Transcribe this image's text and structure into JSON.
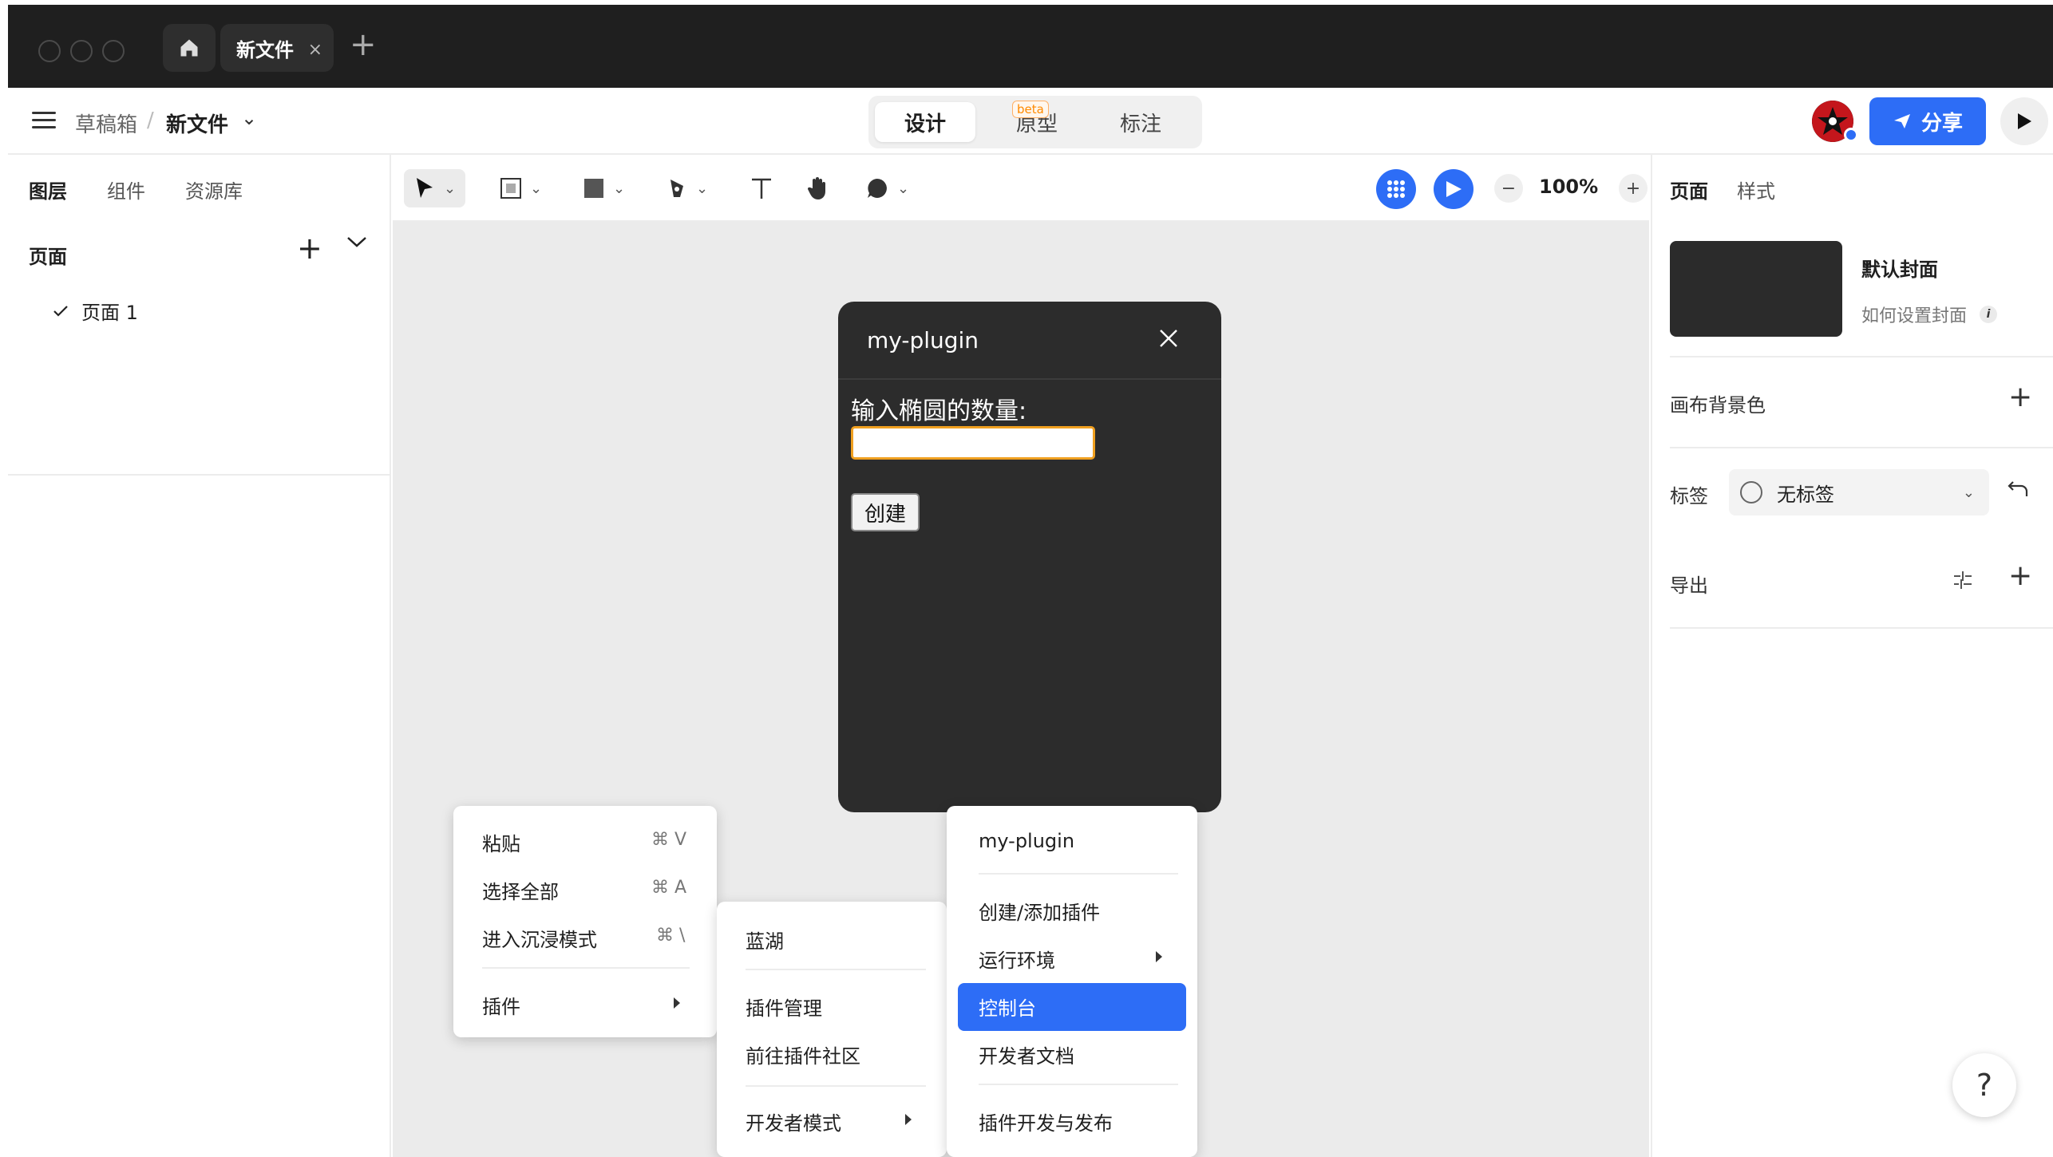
{
  "browser": {
    "tab_title": "新文件",
    "tab_close": "×",
    "tab_add": "+"
  },
  "header": {
    "breadcrumb_parent": "草稿箱",
    "breadcrumb_sep": "/",
    "file_name": "新文件",
    "modes": [
      "设计",
      "原型",
      "标注"
    ],
    "active_mode": "设计",
    "beta_badge": "beta",
    "share_label": "分享",
    "accent_color": "#2d6df6"
  },
  "left_panel": {
    "tabs": [
      "图层",
      "组件",
      "资源库"
    ],
    "pages_header": "页面",
    "pages": [
      {
        "label": "页面 1",
        "checked": true
      }
    ]
  },
  "toolbar": {
    "icons": [
      "move-tool-icon",
      "frame-tool-icon",
      "rectangle-tool-icon",
      "pen-tool-icon",
      "text-tool-icon",
      "hand-tool-icon",
      "comment-tool-icon"
    ],
    "zoom_minus": "−",
    "zoom": "100%",
    "zoom_plus": "+"
  },
  "right_panel": {
    "tabs": [
      "页面",
      "样式"
    ],
    "cover_title": "默认封面",
    "cover_howto": "如何设置封面",
    "canvas_bg_label": "画布背景色",
    "tag_label": "标签",
    "tag_value": "无标签",
    "export_label": "导出"
  },
  "plugin": {
    "title": "my-plugin",
    "label": "输入椭圆的数量:",
    "input_value": "",
    "create_button": "创建"
  },
  "context_menu": {
    "items": [
      {
        "label": "粘贴",
        "shortcut": "⌘ V"
      },
      {
        "label": "选择全部",
        "shortcut": "⌘ A"
      },
      {
        "label": "进入沉浸模式",
        "shortcut": "⌘ \\"
      }
    ],
    "plugins_label": "插件"
  },
  "plugins_submenu": {
    "items": [
      "蓝湖",
      "插件管理",
      "前往插件社区",
      "开发者模式"
    ]
  },
  "dev_submenu": {
    "items": [
      "my-plugin",
      "创建/添加插件",
      "运行环境",
      "控制台",
      "开发者文档",
      "插件开发与发布"
    ],
    "highlighted": "控制台"
  },
  "help": "?"
}
